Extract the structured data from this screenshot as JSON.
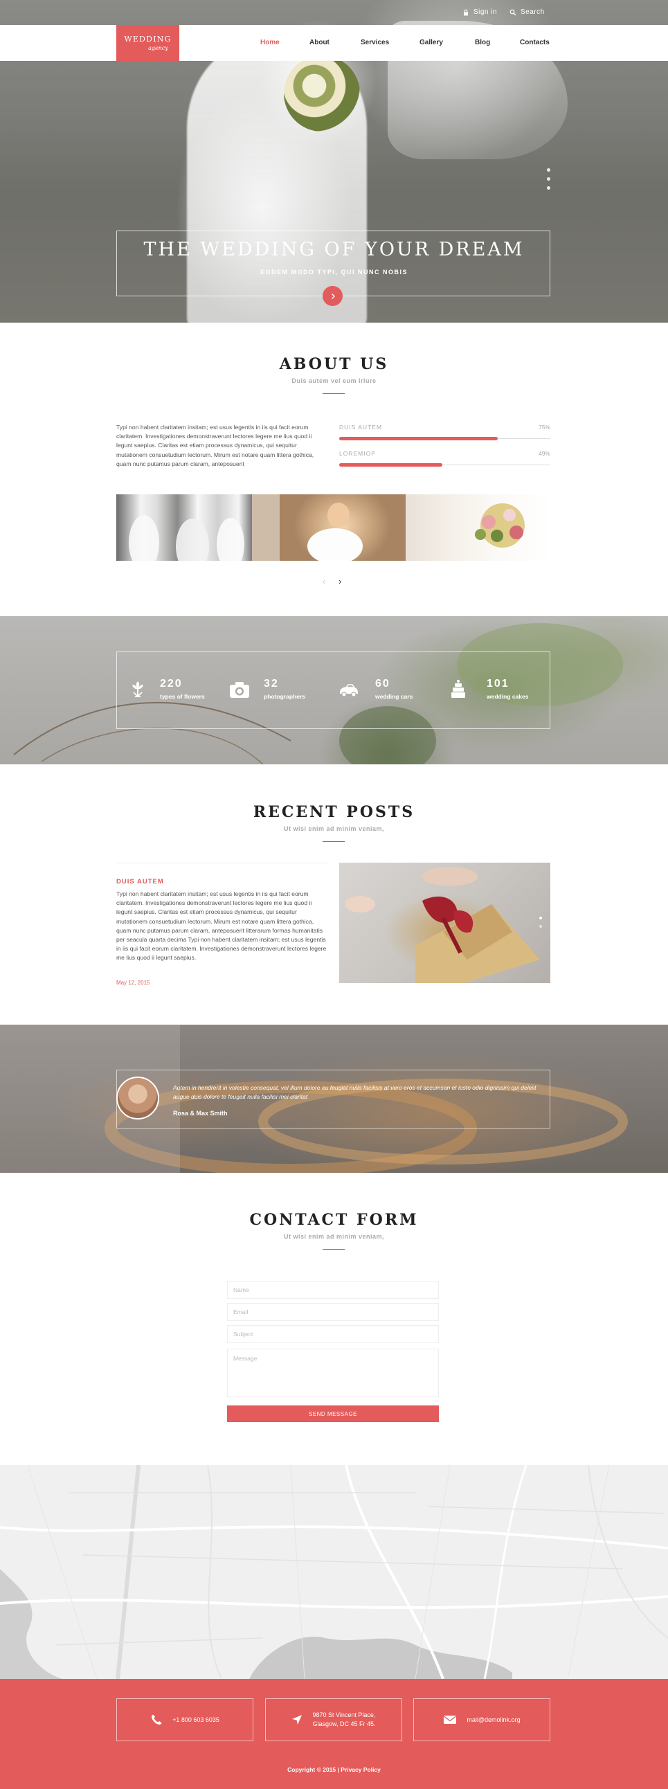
{
  "brand": {
    "name": "WEDDING",
    "tagline": "agency",
    "accent": "#e35b5a"
  },
  "topbar": {
    "signin": "Sign in",
    "search": "Search"
  },
  "nav": {
    "items": [
      "Home",
      "About",
      "Services",
      "Gallery",
      "Blog",
      "Contacts"
    ],
    "active": "Home"
  },
  "hero": {
    "title": "THE WEDDING OF YOUR DREAM",
    "subtitle": "EODEM MODO TYPI, QUI NUNC NOBIS"
  },
  "about": {
    "title": "ABOUT US",
    "subtitle": "Duis autem vel eum iriure",
    "text": "Typi non habent claritatem insitam; est usus legentis in iis qui facit eorum claritatem. Investigationes demonstraverunt lectores legere me lius quod ii legunt saepius. Claritas est etiam processus dynamicus, qui sequitur mutationem consuetudium lectorum. Mirum est notare quam littera gothica, quam nunc putamus parum claram, anteposuerit",
    "skills": [
      {
        "label": "DUIS AUTEM",
        "value": "75%",
        "percent": 75
      },
      {
        "label": "LOREMIOP",
        "value": "49%",
        "percent": 49
      }
    ]
  },
  "stats": [
    {
      "icon": "flower-icon",
      "number": "220",
      "label": "types of flowers"
    },
    {
      "icon": "camera-icon",
      "number": "32",
      "label": "photographers"
    },
    {
      "icon": "car-icon",
      "number": "60",
      "label": "wedding cars"
    },
    {
      "icon": "cake-icon",
      "number": "101",
      "label": "wedding cakes"
    }
  ],
  "posts": {
    "title": "RECENT POSTS",
    "subtitle": "Ut wisi enim ad minim veniam,",
    "post": {
      "title": "DUIS AUTEM",
      "text": "Typi non habent claritatem insitam; est usus legentis in iis qui facit eorum claritatem. Investigationes demonstraverunt lectores legere me lius quod ii legunt saepius. Claritas est etiam processus dynamicus, qui sequitur mutationem consuetudium lectorum. Mirum est notare quam littera gothica, quam nunc putamus parum claram, anteposuerit litterarum formas humanitatis per seacula quarta decima Typi non habent claritatem insitam; est usus legentis in iis qui facit eorum claritatem. Investigationes demonstraverunt lectores legere me lius quod ii legunt saepius.",
      "date": "May 12, 2015"
    }
  },
  "testimonial": {
    "quote": "Autem in hendrerit in volestie consequat, vel illum dolore eu feugiat nulla facilisis at vero eros et accumsan et iusto odio dignissim qui  deleiit augue duis dolore te feugait nulla facilisi mei claritat",
    "author": "Rosa & Max Smith"
  },
  "contact": {
    "title": "CONTACT FORM",
    "subtitle": "Ut wisi enim ad minim veniam,",
    "placeholders": {
      "name": "Name",
      "email": "Email",
      "subject": "Subject",
      "message": "Message"
    },
    "button": "SEND MESSAGE"
  },
  "footer": {
    "phone": "+1 800 603 6035",
    "address_line1": "9870 St Vincent Place,",
    "address_line2": "Glasgow, DC 45 Fr 45.",
    "email": "mail@demolink.org",
    "copyright": "Copyright © 2015 | Privacy Policy"
  }
}
